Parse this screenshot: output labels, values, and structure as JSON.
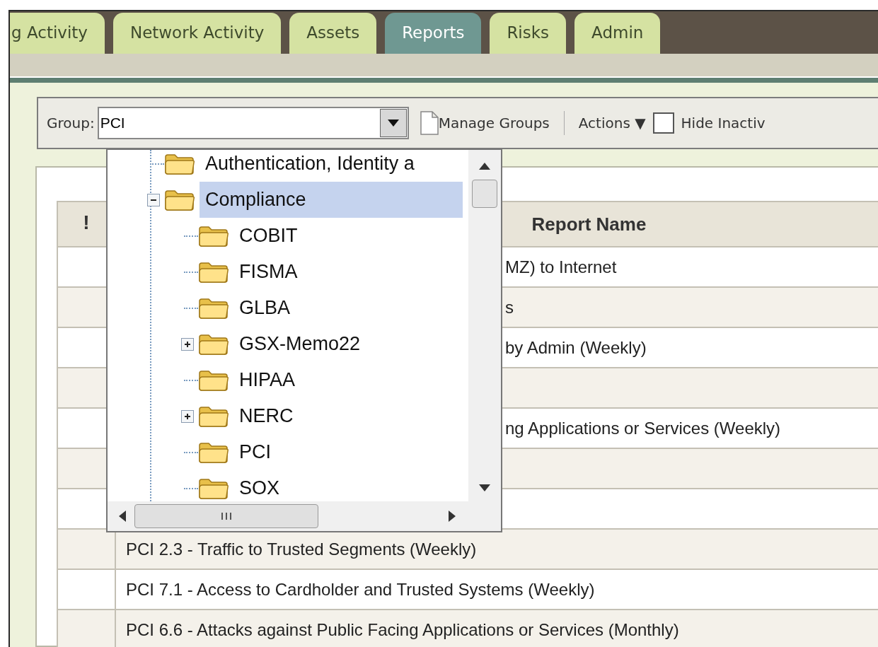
{
  "tabs": [
    {
      "label": "g Activity",
      "selected": false
    },
    {
      "label": "Network Activity",
      "selected": false
    },
    {
      "label": "Assets",
      "selected": false
    },
    {
      "label": "Reports",
      "selected": true
    },
    {
      "label": "Risks",
      "selected": false
    },
    {
      "label": "Admin",
      "selected": false
    }
  ],
  "toolbar": {
    "group_label": "Group:",
    "group_value": "PCI",
    "manage_groups": "Manage Groups",
    "actions": "Actions",
    "actions_caret": "▼",
    "hide_inactive": {
      "label": "Hide Inactiv",
      "checked": false
    }
  },
  "group_tree": [
    {
      "label": "Authentication, Identity a",
      "kind": "leaf",
      "selected": false
    },
    {
      "label": "Compliance",
      "kind": "branch",
      "expanded": true,
      "selected": true,
      "children": [
        {
          "label": "COBIT",
          "kind": "leaf",
          "selected": false
        },
        {
          "label": "FISMA",
          "kind": "leaf",
          "selected": false
        },
        {
          "label": "GLBA",
          "kind": "leaf",
          "selected": false
        },
        {
          "label": "GSX-Memo22",
          "kind": "branch",
          "expanded": false,
          "selected": false
        },
        {
          "label": "HIPAA",
          "kind": "leaf",
          "selected": false
        },
        {
          "label": "NERC",
          "kind": "branch",
          "expanded": false,
          "selected": false
        },
        {
          "label": "PCI",
          "kind": "leaf",
          "selected": false
        },
        {
          "label": "SOX",
          "kind": "leaf",
          "selected": false
        }
      ]
    }
  ],
  "table": {
    "columns": [
      "!",
      "Report Name"
    ],
    "rows": [
      {
        "visible_part": "MZ) to Internet"
      },
      {
        "visible_part": "s"
      },
      {
        "visible_part": "by Admin (Weekly)"
      },
      {},
      {
        "visible_part": "ng Applications or Services (Weekly)"
      },
      {},
      {},
      {
        "name": "PCI 2.3 - Traffic to Trusted Segments (Weekly)"
      },
      {
        "name": "PCI 7.1 - Access to Cardholder and Trusted Systems (Weekly)"
      },
      {
        "name": "PCI 6.6 - Attacks against Public Facing Applications or Services (Monthly)"
      }
    ]
  }
}
